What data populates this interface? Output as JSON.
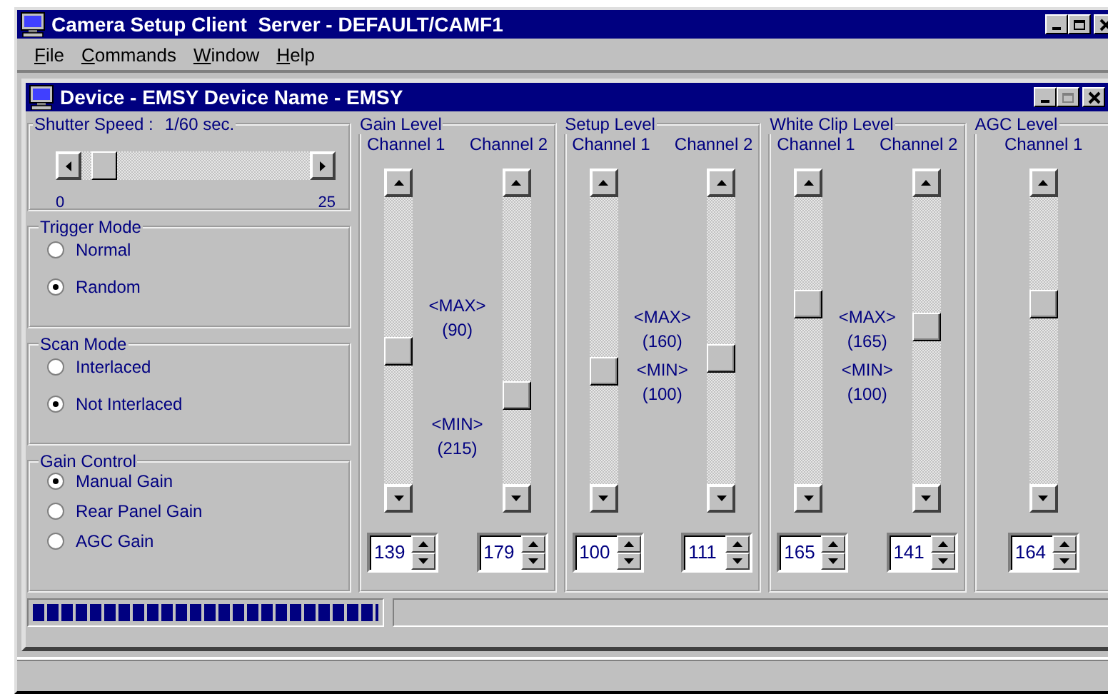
{
  "window": {
    "title": "Camera Setup Client  Server - DEFAULT/CAMF1"
  },
  "menu": [
    {
      "label": "File"
    },
    {
      "label": "Commands"
    },
    {
      "label": "Window"
    },
    {
      "label": "Help"
    }
  ],
  "device_window": {
    "title": "Device - EMSY Device Name - EMSY"
  },
  "shutter": {
    "label": "Shutter Speed :",
    "value": "1/60 sec.",
    "level": 0.05,
    "min": "0",
    "max": "25"
  },
  "radio_groups": [
    {
      "title": "Trigger Mode",
      "kind": "spaced",
      "options": [
        {
          "label": "Normal",
          "selected": false
        },
        {
          "label": "Random",
          "selected": true
        }
      ]
    },
    {
      "title": "Scan Mode",
      "kind": "spaced",
      "options": [
        {
          "label": "Interlaced",
          "selected": false
        },
        {
          "label": "Not Interlaced",
          "selected": true
        }
      ]
    },
    {
      "title": "Gain Control",
      "kind": "compact",
      "options": [
        {
          "label": "Manual Gain",
          "selected": true
        },
        {
          "label": "Rear Panel Gain",
          "selected": false
        },
        {
          "label": "AGC Gain",
          "selected": false
        }
      ]
    }
  ],
  "level_groups": [
    {
      "title": "Gain Level",
      "kind": "wide",
      "channels": [
        {
          "label": "Channel 1",
          "value": "139"
        },
        {
          "label": "Channel 2",
          "value": "179"
        }
      ],
      "notes": {
        "max_label": "<MAX>",
        "max_value": "(90)",
        "min_label": "<MIN>",
        "min_value": "(215)"
      }
    },
    {
      "title": "Setup Level",
      "kind": "tight",
      "channels": [
        {
          "label": "Channel 1",
          "value": "100"
        },
        {
          "label": "Channel 2",
          "value": "111"
        }
      ],
      "notes": {
        "max_label": "<MAX>",
        "max_value": "(160)",
        "min_label": "<MIN>",
        "min_value": "(100)"
      }
    },
    {
      "title": "White Clip Level",
      "kind": "tight",
      "channels": [
        {
          "label": "Channel 1",
          "value": "165"
        },
        {
          "label": "Channel 2",
          "value": "141"
        }
      ],
      "notes": {
        "max_label": "<MAX>",
        "max_value": "(165)",
        "min_label": "<MIN>",
        "min_value": "(100)"
      }
    },
    {
      "title": "AGC Level",
      "kind": "single",
      "channels": [
        {
          "label": "Channel 1",
          "value": "164"
        }
      ]
    }
  ],
  "progress": {
    "level": 1
  }
}
